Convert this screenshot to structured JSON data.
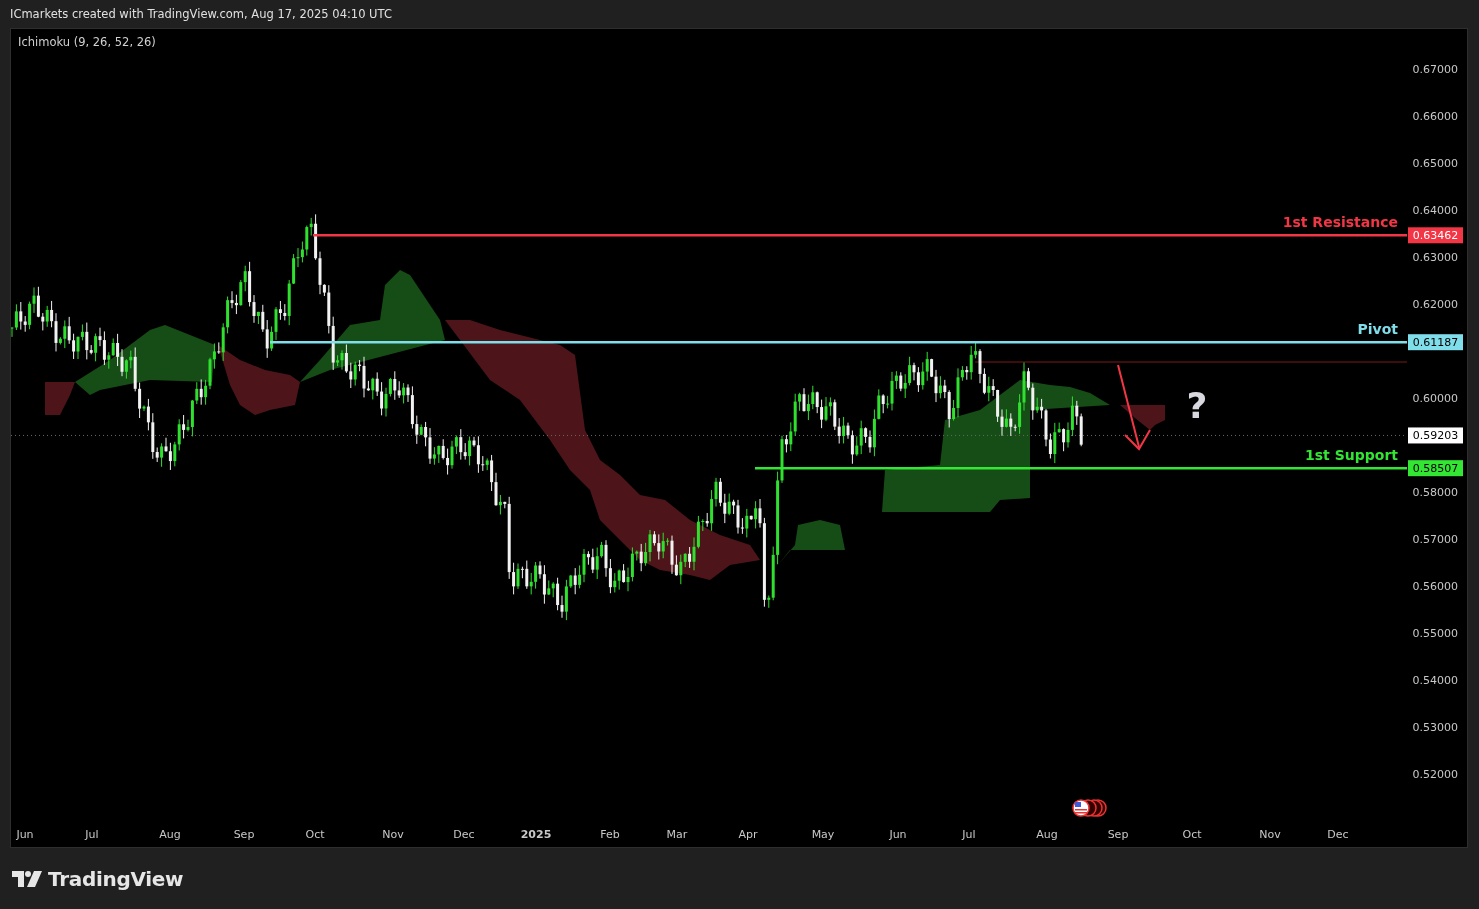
{
  "header": {
    "text": "ICmarkets created with TradingView.com, Aug 17, 2025 04:10 UTC"
  },
  "chart": {
    "indicator": "Ichimoku (9, 26, 52, 26)",
    "price_axis": [
      "0.67000",
      "0.66000",
      "0.65000",
      "0.64000",
      "0.63000",
      "0.62000",
      "0.60000",
      "0.58000",
      "0.57000",
      "0.56000",
      "0.55000",
      "0.54000",
      "0.53000",
      "0.52000"
    ],
    "levels": [
      {
        "kind": "resistance",
        "label": "1st Resistance",
        "price": "0.63462",
        "color": "#f23645"
      },
      {
        "kind": "pivot",
        "label": "Pivot",
        "price": "0.61187",
        "color": "#80deea"
      },
      {
        "kind": "support",
        "label": "1st Support",
        "price": "0.58507",
        "color": "#33e633"
      }
    ],
    "current_price": {
      "price": "0.59203"
    },
    "annotation": {
      "text": "?"
    },
    "time_axis": [
      {
        "label": "Jun",
        "kind": "month"
      },
      {
        "label": "Jul",
        "kind": "month"
      },
      {
        "label": "Aug",
        "kind": "month"
      },
      {
        "label": "Sep",
        "kind": "month"
      },
      {
        "label": "Oct",
        "kind": "month"
      },
      {
        "label": "Nov",
        "kind": "month"
      },
      {
        "label": "Dec",
        "kind": "month"
      },
      {
        "label": "2025",
        "kind": "year"
      },
      {
        "label": "Feb",
        "kind": "month"
      },
      {
        "label": "Mar",
        "kind": "month"
      },
      {
        "label": "Apr",
        "kind": "month"
      },
      {
        "label": "May",
        "kind": "month"
      },
      {
        "label": "Jun",
        "kind": "month"
      },
      {
        "label": "Jul",
        "kind": "month"
      },
      {
        "label": "Aug",
        "kind": "month"
      },
      {
        "label": "Sep",
        "kind": "month"
      },
      {
        "label": "Oct",
        "kind": "month"
      },
      {
        "label": "Nov",
        "kind": "month"
      },
      {
        "label": "Dec",
        "kind": "month"
      }
    ]
  },
  "footer": {
    "logo": "TradingView"
  }
}
